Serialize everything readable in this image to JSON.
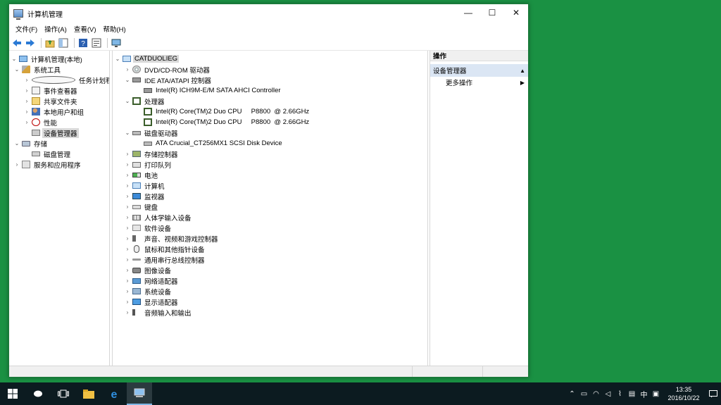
{
  "window": {
    "title": "计算机管理",
    "minimize": "—",
    "maximize": "☐",
    "close": "✕"
  },
  "menu": [
    "文件(F)",
    "操作(A)",
    "查看(V)",
    "帮助(H)"
  ],
  "left_tree": [
    {
      "label": "计算机管理(本地)",
      "icon": "computer-management-icon"
    },
    {
      "label": "系统工具",
      "icon": "system-tools-icon"
    },
    {
      "label": "任务计划程序",
      "icon": "task-scheduler-icon"
    },
    {
      "label": "事件查看器",
      "icon": "event-viewer-icon"
    },
    {
      "label": "共享文件夹",
      "icon": "shared-folders-icon"
    },
    {
      "label": "本地用户和组",
      "icon": "local-users-icon"
    },
    {
      "label": "性能",
      "icon": "performance-icon"
    },
    {
      "label": "设备管理器",
      "icon": "device-manager-icon",
      "selected": true
    },
    {
      "label": "存储",
      "icon": "storage-icon"
    },
    {
      "label": "磁盘管理",
      "icon": "disk-management-icon"
    },
    {
      "label": "服务和应用程序",
      "icon": "services-icon"
    }
  ],
  "device_tree": [
    {
      "label": "CATDUOLIEG",
      "icon": "computer-icon"
    },
    {
      "label": "DVD/CD-ROM 驱动器",
      "icon": "dvd-icon"
    },
    {
      "label": "IDE ATA/ATAPI 控制器",
      "icon": "ide-controller-icon"
    },
    {
      "label": "Intel(R) ICH9M-E/M SATA AHCI Controller",
      "icon": "ide-controller-icon"
    },
    {
      "label": "处理器",
      "icon": "processor-icon"
    },
    {
      "label": "Intel(R) Core(TM)2 Duo CPU     P8800  @ 2.66GHz",
      "icon": "processor-icon"
    },
    {
      "label": "Intel(R) Core(TM)2 Duo CPU     P8800  @ 2.66GHz",
      "icon": "processor-icon"
    },
    {
      "label": "磁盘驱动器",
      "icon": "disk-drive-icon"
    },
    {
      "label": "ATA Crucial_CT256MX1 SCSI Disk Device",
      "icon": "disk-drive-icon"
    },
    {
      "label": "存储控制器",
      "icon": "storage-controller-icon"
    },
    {
      "label": "打印队列",
      "icon": "printer-icon"
    },
    {
      "label": "电池",
      "icon": "battery-icon"
    },
    {
      "label": "计算机",
      "icon": "computer-icon"
    },
    {
      "label": "监视器",
      "icon": "monitor-icon"
    },
    {
      "label": "键盘",
      "icon": "keyboard-icon"
    },
    {
      "label": "人体学输入设备",
      "icon": "hid-icon"
    },
    {
      "label": "软件设备",
      "icon": "software-device-icon"
    },
    {
      "label": "声音、视频和游戏控制器",
      "icon": "sound-icon"
    },
    {
      "label": "鼠标和其他指针设备",
      "icon": "mouse-icon"
    },
    {
      "label": "通用串行总线控制器",
      "icon": "usb-icon"
    },
    {
      "label": "图像设备",
      "icon": "camera-icon"
    },
    {
      "label": "网络适配器",
      "icon": "network-icon"
    },
    {
      "label": "系统设备",
      "icon": "system-device-icon"
    },
    {
      "label": "显示适配器",
      "icon": "display-adapter-icon"
    },
    {
      "label": "音频输入和输出",
      "icon": "audio-icon"
    }
  ],
  "actions": {
    "header": "操作",
    "section": "设备管理器",
    "more": "更多操作"
  },
  "taskbar": {
    "ime": "中",
    "time": "13:35",
    "date": "2016/10/22"
  }
}
